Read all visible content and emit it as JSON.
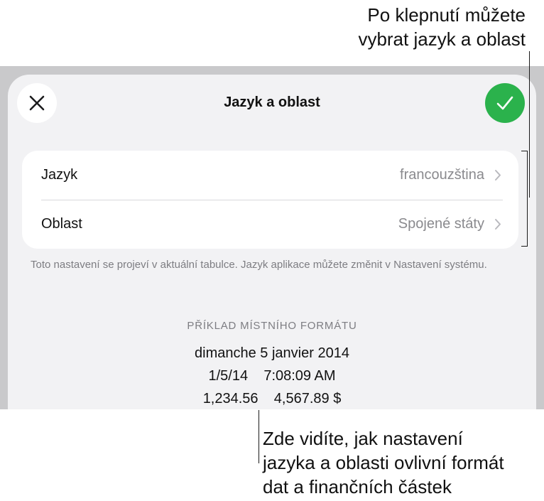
{
  "callouts": {
    "top_line1": "Po klepnutí můžete",
    "top_line2": "vybrat jazyk a oblast",
    "bottom_line1": "Zde vidíte, jak nastavení",
    "bottom_line2": "jazyka a oblasti ovlivní formát",
    "bottom_line3": "dat a finančních částek"
  },
  "sheet": {
    "title": "Jazyk a oblast",
    "close_icon": "close-icon",
    "done_icon": "checkmark-icon",
    "accent_color": "#2bb24c"
  },
  "settings": {
    "rows": [
      {
        "label": "Jazyk",
        "value": "francouzština"
      },
      {
        "label": "Oblast",
        "value": "Spojené státy"
      }
    ],
    "footnote": "Toto nastavení se projeví v aktuální tabulce. Jazyk aplikace můžete změnit v Nastavení systému."
  },
  "example": {
    "heading": "PŘÍKLAD MÍSTNÍHO FORMÁTU",
    "date_long": "dimanche 5 janvier 2014",
    "date_short": "1/5/14",
    "time": "7:08:09 AM",
    "number": "1,234.56",
    "currency": "4,567.89 $"
  }
}
